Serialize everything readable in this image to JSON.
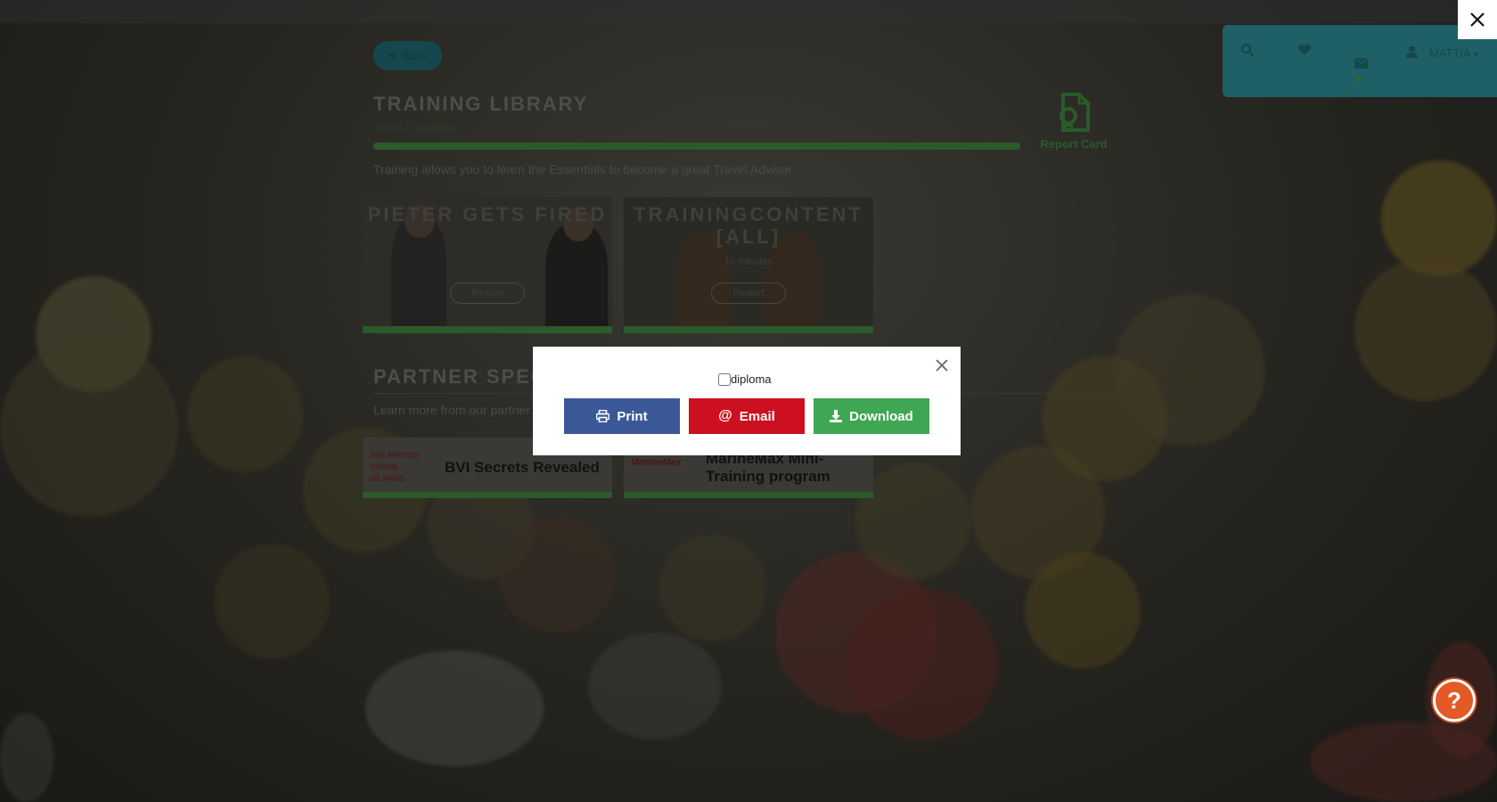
{
  "header": {
    "user_name": "MATTIA",
    "icons": [
      "search-icon",
      "heart-icon",
      "envelope-icon",
      "user-icon",
      "caret-down-icon"
    ]
  },
  "back_label": "Back",
  "training": {
    "title": "TRAINING LIBRARY",
    "progress_label": "100% Complete",
    "progress_value": 1.0,
    "report_card_label": "Report Card",
    "description": "Training allows you to learn the Essentials to become a great Travel Advisor.",
    "cards": [
      {
        "title": "PIETER GETS FIRED",
        "duration": "",
        "action": "Restart"
      },
      {
        "title": "TRAININGCONTENT [ALL]",
        "duration": "10 minutes",
        "action": "Restart"
      }
    ]
  },
  "partner": {
    "title": "PARTNER SPEC",
    "description": "Learn more from our partner",
    "cards": [
      {
        "logo_text": "THE BRITISH VIRGIN ISLANDS",
        "label": "BVI Secrets Revealed"
      },
      {
        "logo_text": "MarineMax",
        "label": "MarineMax Mini-Training program"
      }
    ]
  },
  "modal": {
    "checkbox_label": "diploma",
    "checked": false,
    "print_label": "Print",
    "email_label": "Email",
    "download_label": "Download"
  },
  "help_label": "?",
  "colors": {
    "print": "#3b5998",
    "email": "#cc1020",
    "download": "#3fa653",
    "help": "#e35a27",
    "accent": "#1f5f66"
  }
}
